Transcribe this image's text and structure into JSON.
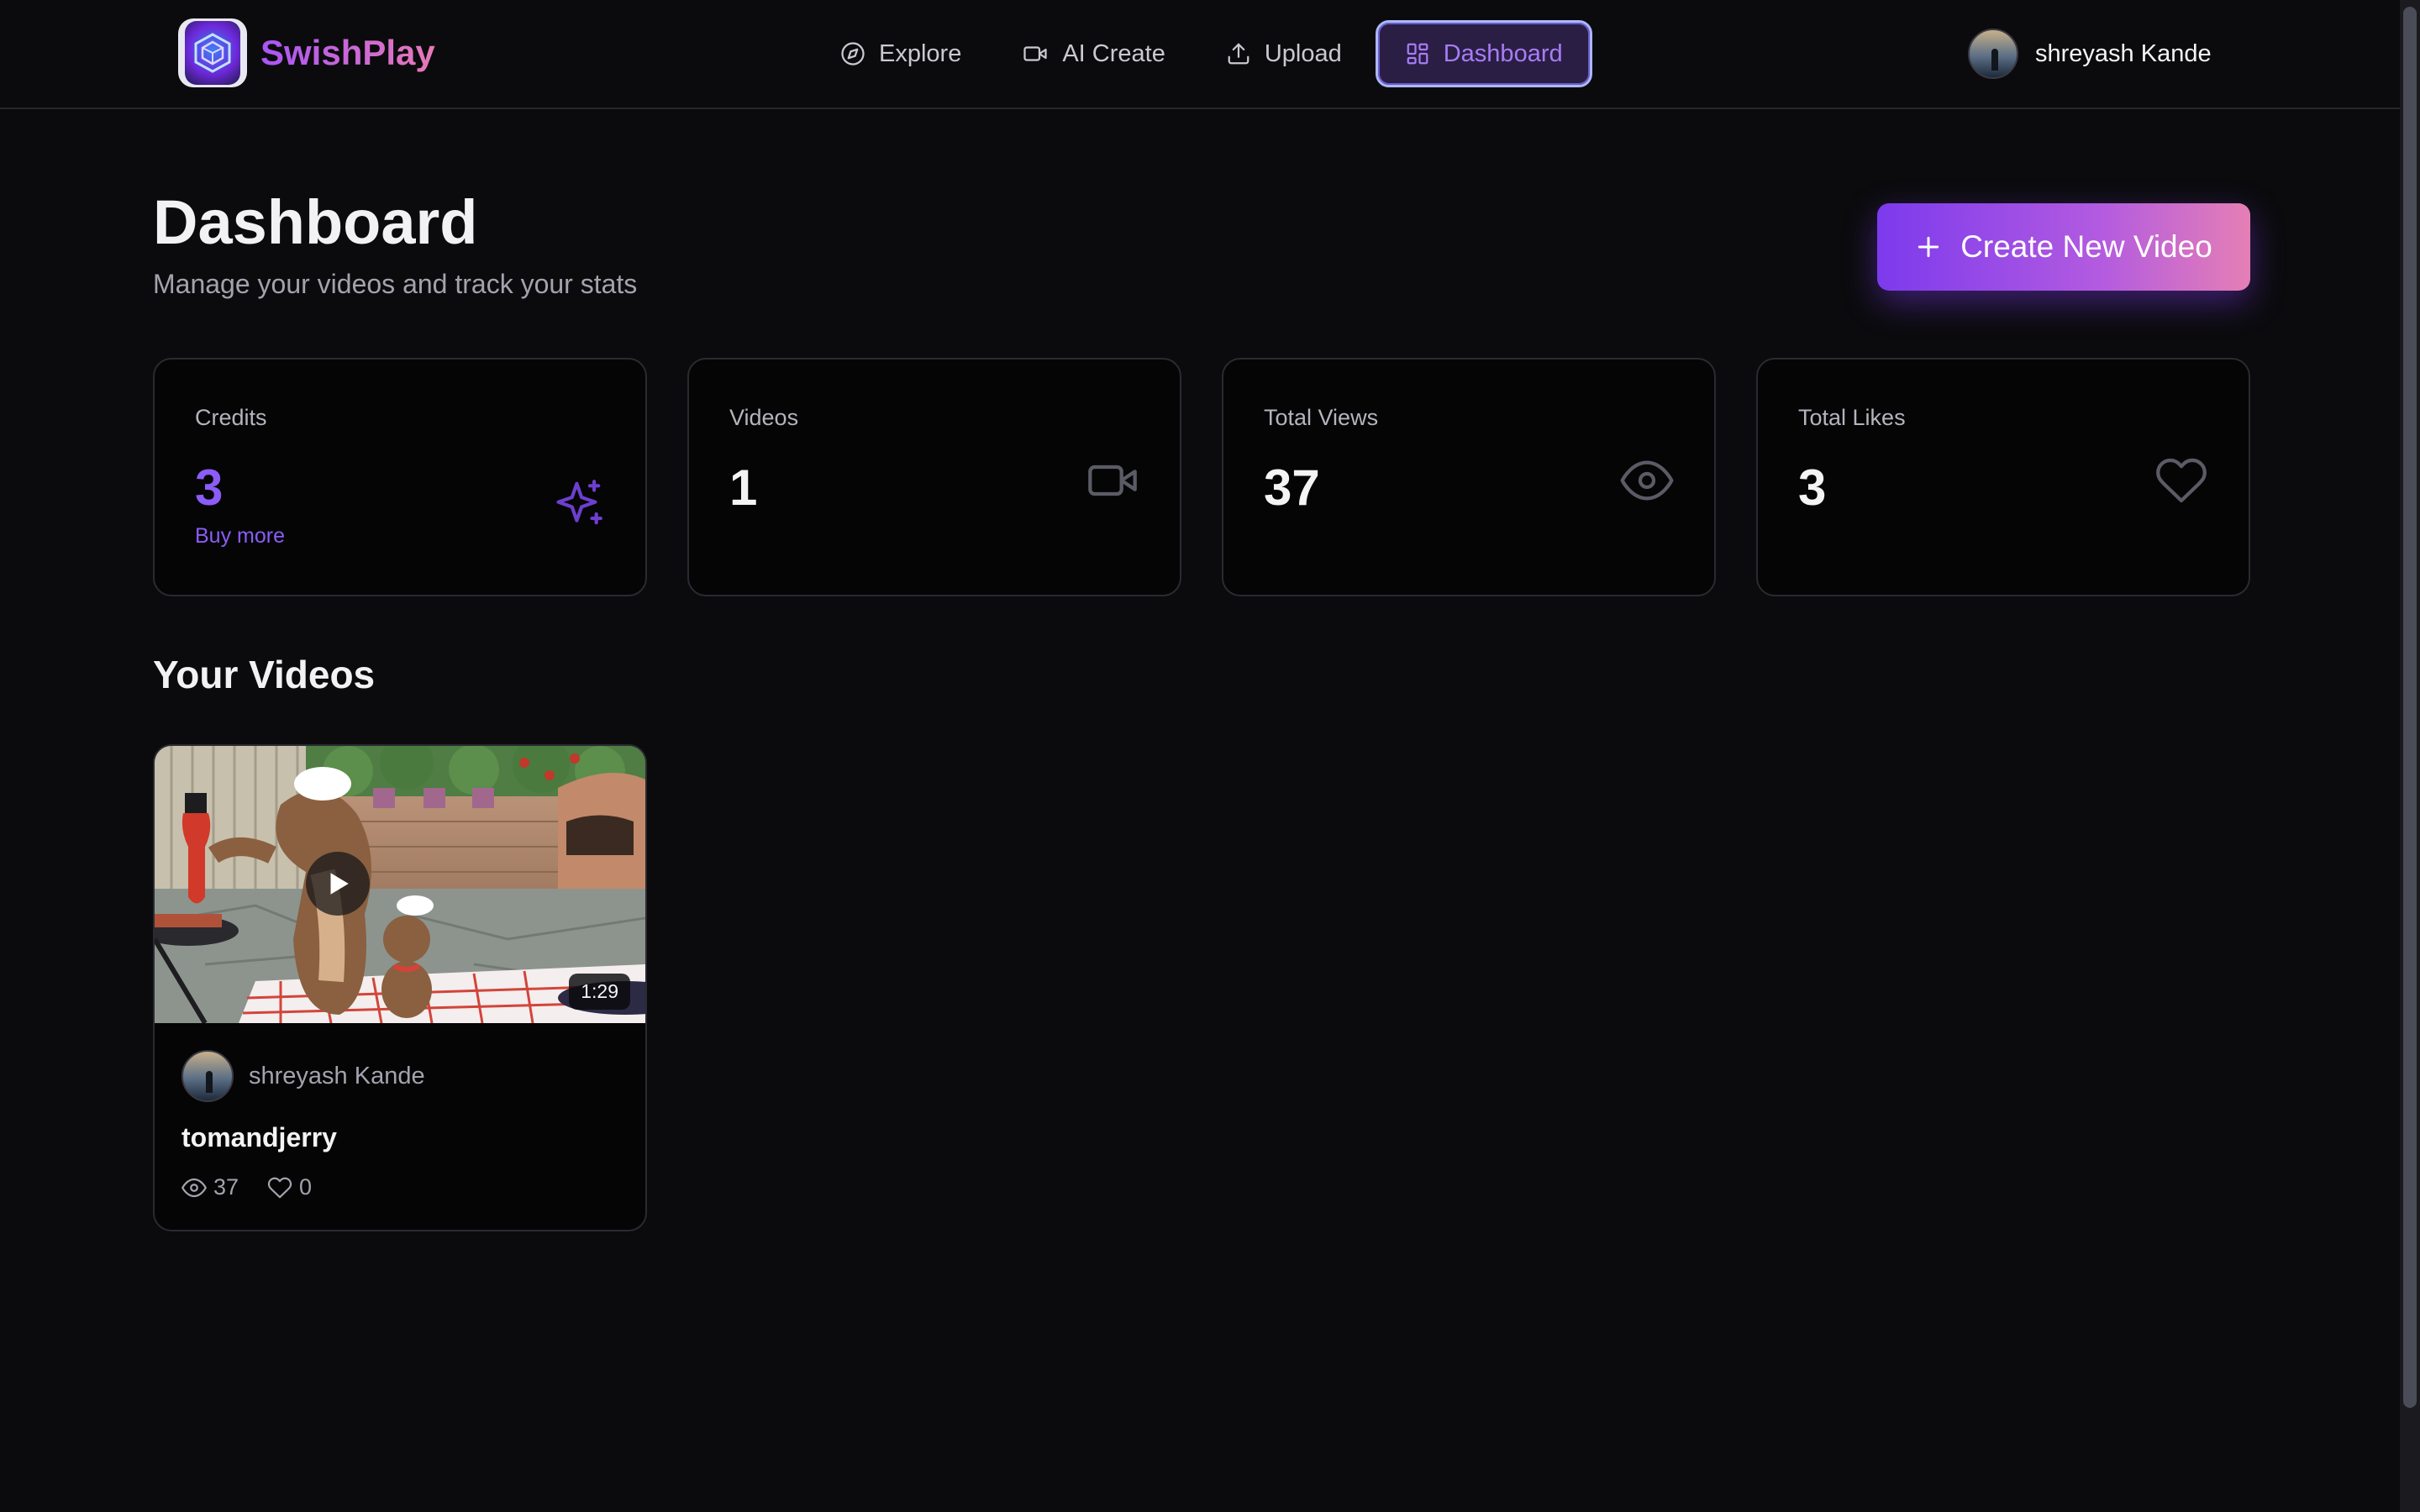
{
  "brand": {
    "name": "SwishPlay",
    "logo_icon": "cube-logo-icon"
  },
  "nav": {
    "items": [
      {
        "label": "Explore",
        "icon": "compass-icon",
        "active": false
      },
      {
        "label": "AI Create",
        "icon": "video-camera-icon",
        "active": false
      },
      {
        "label": "Upload",
        "icon": "upload-icon",
        "active": false
      },
      {
        "label": "Dashboard",
        "icon": "dashboard-grid-icon",
        "active": true
      }
    ]
  },
  "user": {
    "name": "shreyash Kande"
  },
  "header": {
    "title": "Dashboard",
    "subtitle": "Manage your videos and track your stats",
    "create_button": "Create New Video"
  },
  "stats": {
    "credits": {
      "label": "Credits",
      "value": "3",
      "link": "Buy more",
      "icon": "sparkles-icon"
    },
    "videos": {
      "label": "Videos",
      "value": "1",
      "icon": "video-camera-icon"
    },
    "views": {
      "label": "Total Views",
      "value": "37",
      "icon": "eye-icon"
    },
    "likes": {
      "label": "Total Likes",
      "value": "3",
      "icon": "heart-icon"
    }
  },
  "videos_section": {
    "title": "Your Videos",
    "items": [
      {
        "author": "shreyash Kande",
        "title": "tomandjerry",
        "duration": "1:29",
        "views": "37",
        "likes": "0"
      }
    ]
  },
  "colors": {
    "background": "#0b0b0d",
    "card": "#050506",
    "accent": "#8b5cf6",
    "gradient_start": "#7c3aed",
    "gradient_end": "#e57fb5"
  }
}
